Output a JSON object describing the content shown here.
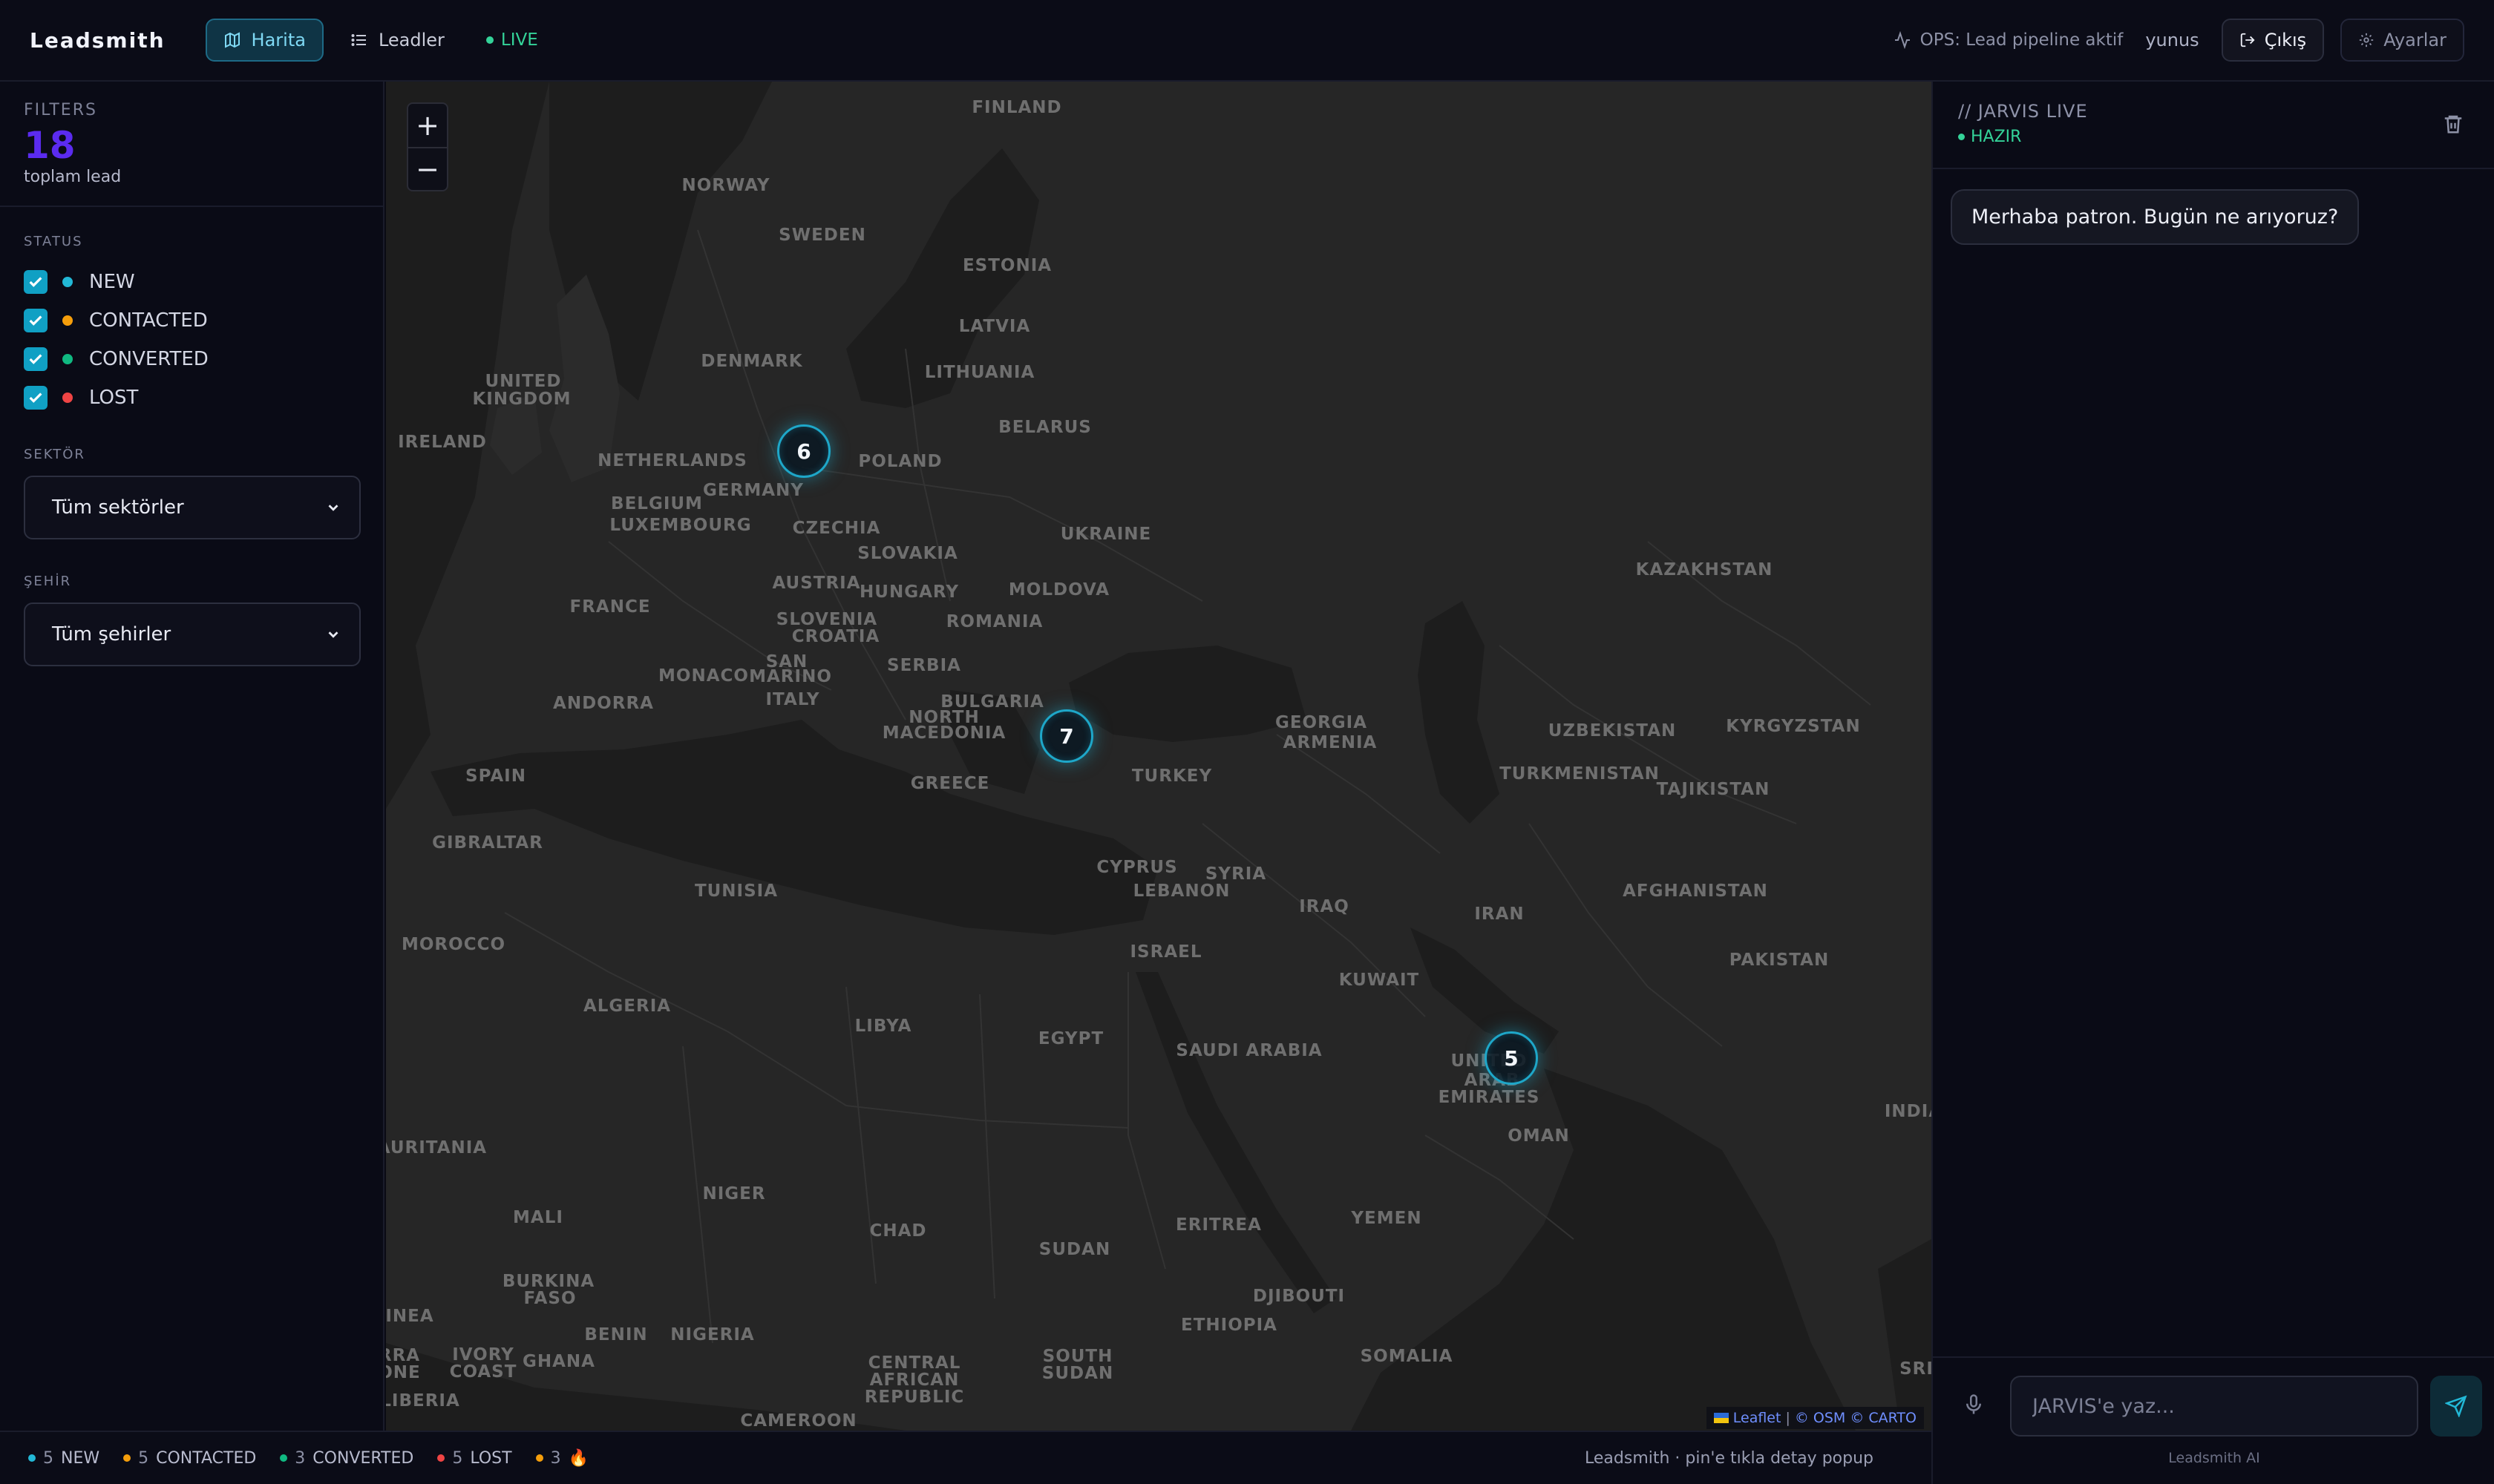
{
  "app": {
    "brand": "Leadsmith",
    "nav": [
      {
        "label": "Harita",
        "icon": "map-icon",
        "active": true
      },
      {
        "label": "Leadler",
        "icon": "list-icon",
        "active": false
      }
    ],
    "live_label": "LIVE",
    "ops_status": "OPS: Lead pipeline aktif",
    "user": "yunus",
    "logout_label": "Çıkış",
    "settings_label": "Ayarlar"
  },
  "sidebar": {
    "filters_title": "FILTERS",
    "lead_count": "18",
    "lead_count_label": "toplam lead",
    "status_title": "STATUS",
    "statuses": [
      {
        "label": "NEW",
        "color": "#22b8d6",
        "checked": true
      },
      {
        "label": "CONTACTED",
        "color": "#f59e0b",
        "checked": true
      },
      {
        "label": "CONVERTED",
        "color": "#10b981",
        "checked": true
      },
      {
        "label": "LOST",
        "color": "#ef4444",
        "checked": true
      }
    ],
    "sector_title": "SEKTÖR",
    "sector_value": "Tüm sektörler",
    "city_title": "ŞEHİR",
    "city_value": "Tüm şehirler"
  },
  "map": {
    "zoom_in": "+",
    "zoom_out": "−",
    "clusters": [
      {
        "count": "6"
      },
      {
        "count": "7"
      },
      {
        "count": "5"
      }
    ],
    "labels": [
      "FINLAND",
      "NORWAY",
      "SWEDEN",
      "ESTONIA",
      "LATVIA",
      "LITHUANIA",
      "DENMARK",
      "UNITED",
      "KINGDOM",
      "IRELAND",
      "NETHERLANDS",
      "BELGIUM",
      "LUXEMBOURG",
      "GERMANY",
      "POLAND",
      "BELARUS",
      "CZECHIA",
      "SLOVAKIA",
      "UKRAINE",
      "AUSTRIA",
      "HUNGARY",
      "MOLDOVA",
      "FRANCE",
      "SLOVENIA",
      "CROATIA",
      "ROMANIA",
      "SAN",
      "MARINO",
      "MONACO",
      "SERBIA",
      "ANDORRA",
      "ITALY",
      "BULGARIA",
      "NORTH",
      "MACEDONIA",
      "GEORGIA",
      "ARMENIA",
      "SPAIN",
      "GREECE",
      "TURKEY",
      "GIBRALTAR",
      "TUNISIA",
      "CYPRUS",
      "LEBANON",
      "SYRIA",
      "IRAQ",
      "IRAN",
      "MOROCCO",
      "ISRAEL",
      "KUWAIT",
      "ALGERIA",
      "LIBYA",
      "EGYPT",
      "SAUDI ARABIA",
      "UNITED",
      "ARAB",
      "EMIRATES",
      "OMAN",
      "KAZAKHSTAN",
      "UZBEKISTAN",
      "KYRGYZSTAN",
      "TURKMENISTAN",
      "TAJIKISTAN",
      "AFGHANISTAN",
      "PAKISTAN",
      "INDIA",
      "MAURITANIA",
      "MALI",
      "NIGER",
      "CHAD",
      "SUDAN",
      "ERITREA",
      "YEMEN",
      "DJIBOUTI",
      "ETHIOPIA",
      "SOMALIA",
      "BURKINA",
      "FASO",
      "BENIN",
      "NIGERIA",
      "GHANA",
      "IVORY",
      "COAST",
      "LIBERIA",
      "CENTRAL",
      "AFRICAN",
      "REPUBLIC",
      "SOUTH",
      "SUDAN",
      "CAMEROON",
      "SRI",
      "INEA",
      "RRA",
      "ONE"
    ],
    "attribution": {
      "leaflet": "Leaflet",
      "sep": "|",
      "osm": "© OSM",
      "carto": "© CARTO"
    }
  },
  "chat": {
    "title": "// JARVIS LIVE",
    "status": "HAZIR",
    "greeting": "Merhaba patron. Bugün ne arıyoruz?",
    "input_placeholder": "JARVIS'e yaz...",
    "powered_by": "Leadsmith AI"
  },
  "statusbar": {
    "stats": [
      {
        "count": "5",
        "label": "NEW",
        "color": "#22b8d6"
      },
      {
        "count": "5",
        "label": "CONTACTED",
        "color": "#f59e0b"
      },
      {
        "count": "3",
        "label": "CONVERTED",
        "color": "#10b981"
      },
      {
        "count": "5",
        "label": "LOST",
        "color": "#ef4444"
      },
      {
        "count": "3",
        "label": "🔥",
        "color": "#f59e0b"
      }
    ],
    "note": "Leadsmith · pin'e tıkla detay popup"
  }
}
